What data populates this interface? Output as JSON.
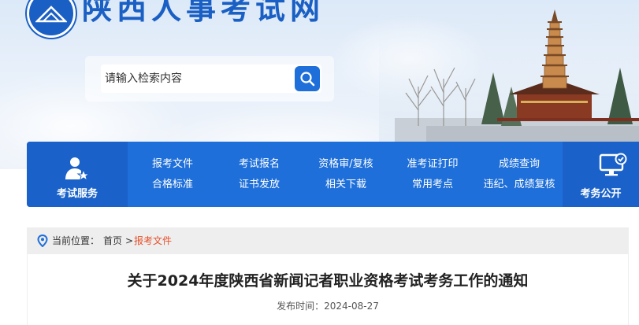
{
  "site": {
    "title": "陕西人事考试网"
  },
  "search": {
    "placeholder": "请输入检索内容"
  },
  "nav": {
    "left_label": "考试服务",
    "right_label": "考务公开",
    "links_row1": [
      "报考文件",
      "考试报名",
      "资格审/复核",
      "准考证打印",
      "成绩查询"
    ],
    "links_row2": [
      "合格标准",
      "证书发放",
      "相关下载",
      "常用考点",
      "违纪、成绩复核"
    ]
  },
  "breadcrumb": {
    "prefix": "当前位置：",
    "home": "首页",
    "separator": ">",
    "current": "报考文件"
  },
  "article": {
    "title": "关于2024年度陕西省新闻记者职业资格考试考务工作的通知",
    "publish_label": "发布时间：",
    "publish_date": "2024-08-27"
  },
  "colors": {
    "brand_blue": "#1e6fd9",
    "breadcrumb_accent": "#e8502a"
  },
  "icons": [
    "logo-emblem-icon",
    "search-icon",
    "user-star-icon",
    "monitor-check-icon",
    "location-pin-icon"
  ]
}
